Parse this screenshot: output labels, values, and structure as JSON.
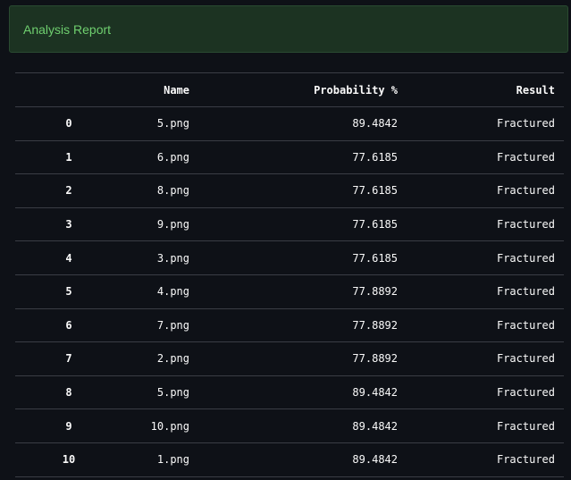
{
  "alert": {
    "text": "Analysis Report"
  },
  "table": {
    "columns": [
      "",
      "Name",
      "Probability %",
      "Result"
    ],
    "rows": [
      {
        "index": "0",
        "name": "5.png",
        "probability": "89.4842",
        "result": "Fractured"
      },
      {
        "index": "1",
        "name": "6.png",
        "probability": "77.6185",
        "result": "Fractured"
      },
      {
        "index": "2",
        "name": "8.png",
        "probability": "77.6185",
        "result": "Fractured"
      },
      {
        "index": "3",
        "name": "9.png",
        "probability": "77.6185",
        "result": "Fractured"
      },
      {
        "index": "4",
        "name": "3.png",
        "probability": "77.6185",
        "result": "Fractured"
      },
      {
        "index": "5",
        "name": "4.png",
        "probability": "77.8892",
        "result": "Fractured"
      },
      {
        "index": "6",
        "name": "7.png",
        "probability": "77.8892",
        "result": "Fractured"
      },
      {
        "index": "7",
        "name": "2.png",
        "probability": "77.8892",
        "result": "Fractured"
      },
      {
        "index": "8",
        "name": "5.png",
        "probability": "89.4842",
        "result": "Fractured"
      },
      {
        "index": "9",
        "name": "10.png",
        "probability": "89.4842",
        "result": "Fractured"
      },
      {
        "index": "10",
        "name": "1.png",
        "probability": "89.4842",
        "result": "Fractured"
      }
    ]
  },
  "colors": {
    "background": "#0e1117",
    "alert_background": "#1c3322",
    "alert_text": "#6fcf6f",
    "grid_line": "#3a3d45"
  }
}
